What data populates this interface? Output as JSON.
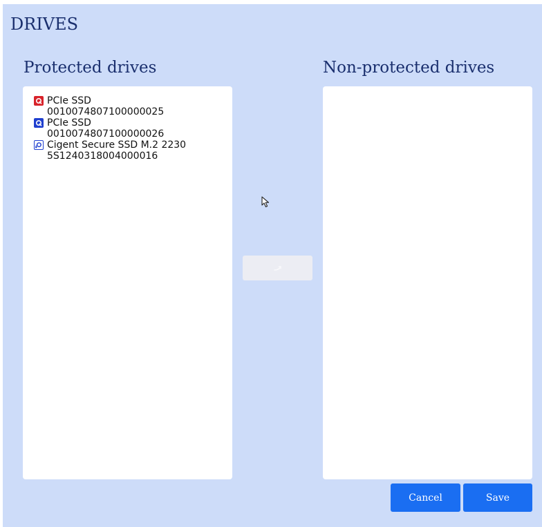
{
  "page": {
    "title": "DRIVES"
  },
  "protected": {
    "heading": "Protected drives",
    "drives": [
      {
        "name": "PCIe SSD",
        "serial": "0010074807100000025",
        "icon": "drive-lock-red-icon"
      },
      {
        "name": "PCIe SSD",
        "serial": "0010074807100000026",
        "icon": "drive-lock-blue-icon"
      },
      {
        "name": "Cigent Secure SSD M.2 2230",
        "serial": "5S1240318004000016",
        "icon": "drive-lock-outline-icon"
      }
    ]
  },
  "non_protected": {
    "heading": "Non-protected drives",
    "drives": []
  },
  "actions": {
    "move_icon": "transfer-arrow-icon",
    "cancel_label": "Cancel",
    "save_label": "Save"
  },
  "colors": {
    "background": "#cddcf9",
    "title_text": "#1a2f6e",
    "primary_button": "#1a6ef2",
    "icon_red": "#d8232a",
    "icon_blue": "#1f3fcf"
  }
}
